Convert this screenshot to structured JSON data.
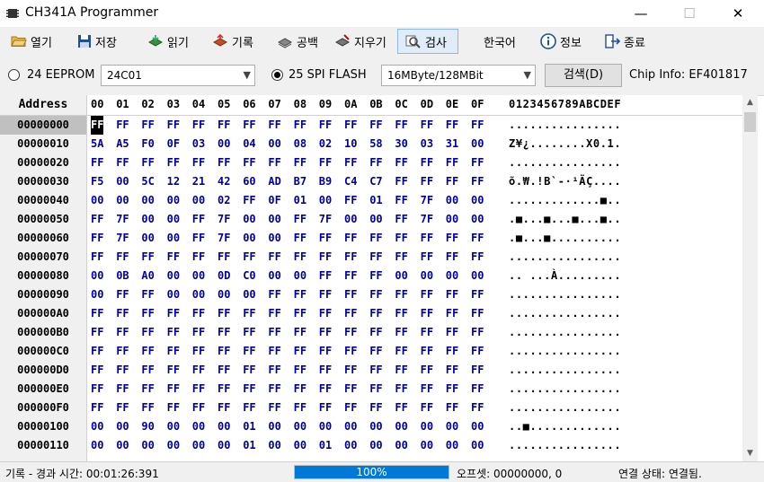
{
  "window": {
    "title": "CH341A Programmer",
    "minimize": "—",
    "maximize": "☐",
    "close": "✕"
  },
  "toolbar": {
    "open": "열기",
    "save": "저장",
    "read": "읽기",
    "write": "기록",
    "blank": "공백",
    "erase": "지우기",
    "verify": "검사",
    "language": "한국어",
    "about": "정보",
    "exit": "종료"
  },
  "options": {
    "eeprom_label": "24 EEPROM",
    "eeprom_value": "24C01",
    "spi_label": "25 SPI FLASH",
    "spi_value": "16MByte/128MBit",
    "detect_button": "검색(D)",
    "chip_info": "Chip Info: EF401817",
    "selected_mode": "spi"
  },
  "hex": {
    "address_header": "Address",
    "columns": [
      "00",
      "01",
      "02",
      "03",
      "04",
      "05",
      "06",
      "07",
      "08",
      "09",
      "0A",
      "0B",
      "0C",
      "0D",
      "0E",
      "0F"
    ],
    "ascii_header": "0123456789ABCDEF",
    "selected_row": 0,
    "cursor_cell": [
      0,
      0
    ],
    "rows": [
      {
        "addr": "00000000",
        "bytes": [
          "FF",
          "FF",
          "FF",
          "FF",
          "FF",
          "FF",
          "FF",
          "FF",
          "FF",
          "FF",
          "FF",
          "FF",
          "FF",
          "FF",
          "FF",
          "FF"
        ],
        "ascii": "................"
      },
      {
        "addr": "00000010",
        "bytes": [
          "5A",
          "A5",
          "F0",
          "0F",
          "03",
          "00",
          "04",
          "00",
          "08",
          "02",
          "10",
          "58",
          "30",
          "03",
          "31",
          "00"
        ],
        "ascii": "Z¥¿........X0.1."
      },
      {
        "addr": "00000020",
        "bytes": [
          "FF",
          "FF",
          "FF",
          "FF",
          "FF",
          "FF",
          "FF",
          "FF",
          "FF",
          "FF",
          "FF",
          "FF",
          "FF",
          "FF",
          "FF",
          "FF"
        ],
        "ascii": "................"
      },
      {
        "addr": "00000030",
        "bytes": [
          "F5",
          "00",
          "5C",
          "12",
          "21",
          "42",
          "60",
          "AD",
          "B7",
          "B9",
          "C4",
          "C7",
          "FF",
          "FF",
          "FF",
          "FF"
        ],
        "ascii": "õ.₩.!B`-·¹ÄÇ...."
      },
      {
        "addr": "00000040",
        "bytes": [
          "00",
          "00",
          "00",
          "00",
          "00",
          "02",
          "FF",
          "0F",
          "01",
          "00",
          "FF",
          "01",
          "FF",
          "7F",
          "00",
          "00"
        ],
        "ascii": ".............■.."
      },
      {
        "addr": "00000050",
        "bytes": [
          "FF",
          "7F",
          "00",
          "00",
          "FF",
          "7F",
          "00",
          "00",
          "FF",
          "7F",
          "00",
          "00",
          "FF",
          "7F",
          "00",
          "00"
        ],
        "ascii": ".■...■...■...■.."
      },
      {
        "addr": "00000060",
        "bytes": [
          "FF",
          "7F",
          "00",
          "00",
          "FF",
          "7F",
          "00",
          "00",
          "FF",
          "FF",
          "FF",
          "FF",
          "FF",
          "FF",
          "FF",
          "FF"
        ],
        "ascii": ".■...■.........."
      },
      {
        "addr": "00000070",
        "bytes": [
          "FF",
          "FF",
          "FF",
          "FF",
          "FF",
          "FF",
          "FF",
          "FF",
          "FF",
          "FF",
          "FF",
          "FF",
          "FF",
          "FF",
          "FF",
          "FF"
        ],
        "ascii": "................"
      },
      {
        "addr": "00000080",
        "bytes": [
          "00",
          "0B",
          "A0",
          "00",
          "00",
          "0D",
          "C0",
          "00",
          "00",
          "FF",
          "FF",
          "FF",
          "00",
          "00",
          "00",
          "00"
        ],
        "ascii": ".. ...À........."
      },
      {
        "addr": "00000090",
        "bytes": [
          "00",
          "FF",
          "FF",
          "00",
          "00",
          "00",
          "00",
          "FF",
          "FF",
          "FF",
          "FF",
          "FF",
          "FF",
          "FF",
          "FF",
          "FF"
        ],
        "ascii": "................"
      },
      {
        "addr": "000000A0",
        "bytes": [
          "FF",
          "FF",
          "FF",
          "FF",
          "FF",
          "FF",
          "FF",
          "FF",
          "FF",
          "FF",
          "FF",
          "FF",
          "FF",
          "FF",
          "FF",
          "FF"
        ],
        "ascii": "................"
      },
      {
        "addr": "000000B0",
        "bytes": [
          "FF",
          "FF",
          "FF",
          "FF",
          "FF",
          "FF",
          "FF",
          "FF",
          "FF",
          "FF",
          "FF",
          "FF",
          "FF",
          "FF",
          "FF",
          "FF"
        ],
        "ascii": "................"
      },
      {
        "addr": "000000C0",
        "bytes": [
          "FF",
          "FF",
          "FF",
          "FF",
          "FF",
          "FF",
          "FF",
          "FF",
          "FF",
          "FF",
          "FF",
          "FF",
          "FF",
          "FF",
          "FF",
          "FF"
        ],
        "ascii": "................"
      },
      {
        "addr": "000000D0",
        "bytes": [
          "FF",
          "FF",
          "FF",
          "FF",
          "FF",
          "FF",
          "FF",
          "FF",
          "FF",
          "FF",
          "FF",
          "FF",
          "FF",
          "FF",
          "FF",
          "FF"
        ],
        "ascii": "................"
      },
      {
        "addr": "000000E0",
        "bytes": [
          "FF",
          "FF",
          "FF",
          "FF",
          "FF",
          "FF",
          "FF",
          "FF",
          "FF",
          "FF",
          "FF",
          "FF",
          "FF",
          "FF",
          "FF",
          "FF"
        ],
        "ascii": "................"
      },
      {
        "addr": "000000F0",
        "bytes": [
          "FF",
          "FF",
          "FF",
          "FF",
          "FF",
          "FF",
          "FF",
          "FF",
          "FF",
          "FF",
          "FF",
          "FF",
          "FF",
          "FF",
          "FF",
          "FF"
        ],
        "ascii": "................"
      },
      {
        "addr": "00000100",
        "bytes": [
          "00",
          "00",
          "90",
          "00",
          "00",
          "00",
          "01",
          "00",
          "00",
          "00",
          "00",
          "00",
          "00",
          "00",
          "00",
          "00"
        ],
        "ascii": "..■............."
      },
      {
        "addr": "00000110",
        "bytes": [
          "00",
          "00",
          "00",
          "00",
          "00",
          "00",
          "01",
          "00",
          "00",
          "01",
          "00",
          "00",
          "00",
          "00",
          "00",
          "00"
        ],
        "ascii": "................"
      }
    ]
  },
  "status": {
    "elapsed": "기록 - 경과 시간: 00:01:26:391",
    "progress_text": "100%",
    "progress_value": 1.0,
    "offset": "오프셋: 00000000, 0",
    "connection": "연결 상태: 연결됨."
  },
  "colors": {
    "hex_text": "#0000a0",
    "progress": "#0078d7"
  }
}
